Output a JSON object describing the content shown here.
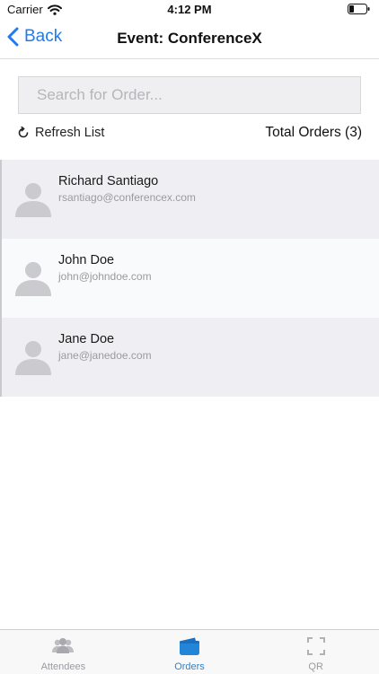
{
  "status_bar": {
    "carrier": "Carrier",
    "time": "4:12 PM"
  },
  "nav": {
    "back_label": "Back",
    "title": "Event: ConferenceX"
  },
  "search": {
    "placeholder": "Search for Order...",
    "value": ""
  },
  "toolbar": {
    "refresh_label": "Refresh List",
    "total_orders_label": "Total Orders (3)"
  },
  "orders": [
    {
      "name": "Richard Santiago",
      "email": "rsantiago@conferencex.com"
    },
    {
      "name": "John Doe",
      "email": "john@johndoe.com"
    },
    {
      "name": "Jane Doe",
      "email": "jane@janedoe.com"
    }
  ],
  "tabs": [
    {
      "label": "Attendees",
      "icon": "attendees-icon",
      "active": false
    },
    {
      "label": "Orders",
      "icon": "orders-icon",
      "active": true
    },
    {
      "label": "QR",
      "icon": "qr-scan-icon",
      "active": false
    }
  ],
  "colors": {
    "accent": "#1e7cf0",
    "tab_active": "#2385d8",
    "tab_inactive": "#9a9aa0",
    "row_odd": "#efeff3",
    "row_even": "#f9fafc",
    "avatar": "#cbcbcf"
  }
}
